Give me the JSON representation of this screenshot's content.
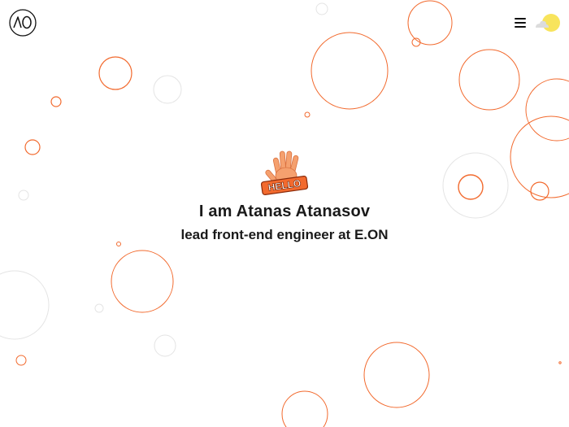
{
  "header": {
    "logo_icon": "ao-monogram-logo",
    "menu_icon": "hamburger-menu-icon",
    "theme_icon": "sun-with-cloud-icon",
    "theme_colors": {
      "sun": "#f8e45c",
      "cloud": "#dcdcdc"
    }
  },
  "hero": {
    "greeting_icon": "hello-waving-hand-icon",
    "greeting_text": "HELLO",
    "name": "I am Atanas Atanasov",
    "role": "lead front-end engineer at E.ON"
  },
  "colors": {
    "accent": "#f26a2e",
    "bubble_faint": "#e4e4e4",
    "text": "#1a1a1a",
    "background": "#ffffff"
  }
}
